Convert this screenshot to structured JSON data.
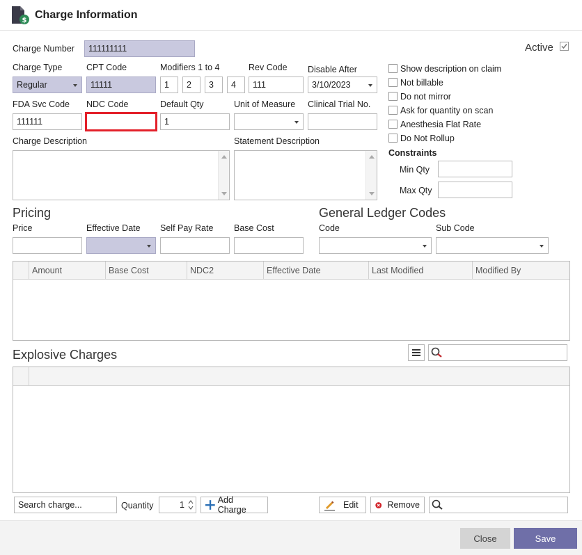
{
  "window": {
    "title": "Charge Information"
  },
  "form": {
    "charge_number": {
      "label": "Charge Number",
      "value": "111111111"
    },
    "active": {
      "label": "Active",
      "checked": true
    },
    "charge_type": {
      "label": "Charge Type",
      "value": "Regular"
    },
    "cpt_code": {
      "label": "CPT Code",
      "value": "11111"
    },
    "modifiers": {
      "label": "Modifiers 1 to 4",
      "values": [
        "1",
        "2",
        "3",
        "4"
      ]
    },
    "rev_code": {
      "label": "Rev Code",
      "value": "111"
    },
    "disable_after": {
      "label": "Disable After",
      "value": "3/10/2023"
    },
    "fda_svc_code": {
      "label": "FDA Svc Code",
      "value": "111111"
    },
    "ndc_code": {
      "label": "NDC Code",
      "value": ""
    },
    "default_qty": {
      "label": "Default Qty",
      "value": "1"
    },
    "unit_of_measure": {
      "label": "Unit of Measure",
      "value": ""
    },
    "clinical_trial": {
      "label": "Clinical Trial No.",
      "value": ""
    },
    "charge_description": {
      "label": "Charge Description",
      "value": ""
    },
    "statement_description": {
      "label": "Statement Description",
      "value": ""
    }
  },
  "options": [
    {
      "label": "Show description on claim",
      "checked": false
    },
    {
      "label": "Not billable",
      "checked": false
    },
    {
      "label": "Do not mirror",
      "checked": false
    },
    {
      "label": "Ask for quantity on scan",
      "checked": false
    },
    {
      "label": "Anesthesia Flat Rate",
      "checked": false
    },
    {
      "label": "Do Not Rollup",
      "checked": false
    }
  ],
  "constraints": {
    "title": "Constraints",
    "min_qty": {
      "label": "Min Qty",
      "value": ""
    },
    "max_qty": {
      "label": "Max Qty",
      "value": ""
    }
  },
  "pricing": {
    "title": "Pricing",
    "price": {
      "label": "Price",
      "value": ""
    },
    "effective_date": {
      "label": "Effective Date",
      "value": ""
    },
    "self_pay_rate": {
      "label": "Self Pay Rate",
      "value": ""
    },
    "base_cost": {
      "label": "Base Cost",
      "value": ""
    }
  },
  "gl_codes": {
    "title": "General Ledger Codes",
    "code": {
      "label": "Code",
      "value": ""
    },
    "sub_code": {
      "label": "Sub Code",
      "value": ""
    }
  },
  "price_grid": {
    "columns": [
      "Amount",
      "Base Cost",
      "NDC2",
      "Effective Date",
      "Last Modified",
      "Modified By"
    ]
  },
  "explosive": {
    "title": "Explosive Charges",
    "search_placeholder": "Search charge...",
    "quantity_label": "Quantity",
    "quantity_value": "1",
    "add_label": "Add Charge",
    "edit_label": "Edit",
    "remove_label": "Remove"
  },
  "footer": {
    "close_label": "Close",
    "save_label": "Save"
  },
  "colors": {
    "readonly_bg": "#c9c9df",
    "highlight_border": "#e3202a",
    "save_bg": "#6f6fa8",
    "close_bg": "#d4d4d4"
  },
  "icons": [
    "document-dollar-icon",
    "menu-icon",
    "search-icon",
    "plus-icon",
    "pencil-icon",
    "remove-circle-icon"
  ]
}
